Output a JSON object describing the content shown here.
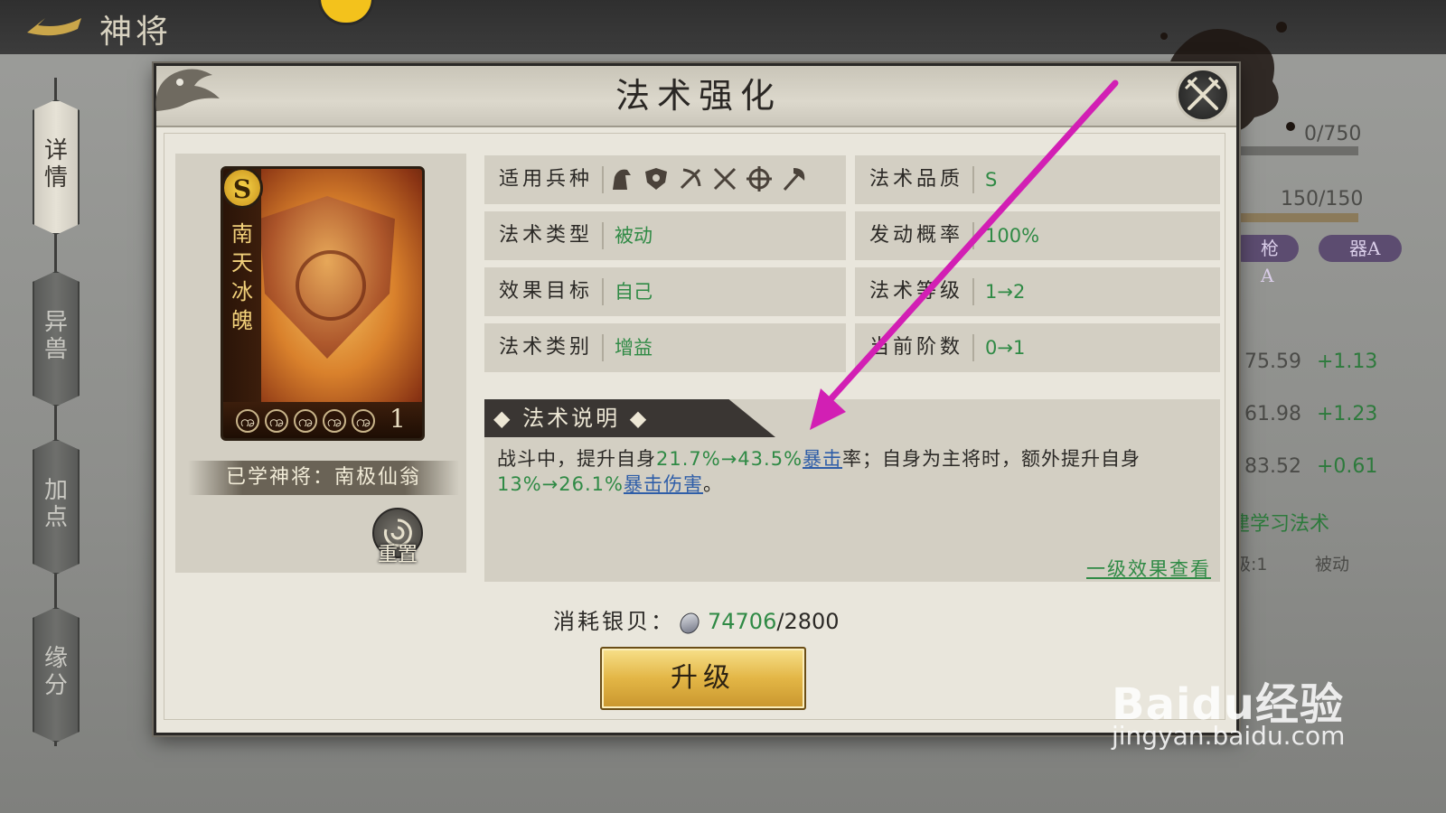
{
  "page": {
    "title": "神将",
    "side_tabs": [
      "详情",
      "异兽",
      "加点",
      "缘分"
    ]
  },
  "background_panel": {
    "progress_1": "0/750",
    "progress_2": "150/150",
    "tag_1": "枪A",
    "tag_2": "器A",
    "stats": [
      {
        "value": "75.59",
        "delta": "+1.13"
      },
      {
        "value": "61.98",
        "delta": "+1.23"
      },
      {
        "value": "83.52",
        "delta": "+0.61"
      }
    ],
    "learn_link": "建学习法术",
    "level_text": "级:1",
    "type_text": "被动"
  },
  "dialog": {
    "title": "法术强化",
    "card": {
      "grade": "S",
      "name": "南天冰魄",
      "level": "1"
    },
    "learned_by": "已学神将：南极仙翁",
    "reset_label": "重置",
    "info": {
      "unit_type": {
        "label": "适用兵种",
        "icons": [
          "cavalry-icon",
          "shield-icon",
          "bow-icon",
          "crossed-swords-icon",
          "crosshair-icon",
          "axe-icon"
        ]
      },
      "quality": {
        "label": "法术品质",
        "value": "S"
      },
      "spell_type": {
        "label": "法术类型",
        "value": "被动"
      },
      "trigger_rate": {
        "label": "发动概率",
        "value": "100%"
      },
      "target": {
        "label": "效果目标",
        "value": "自己"
      },
      "spell_level": {
        "label": "法术等级",
        "value": "1→2"
      },
      "category": {
        "label": "法术类别",
        "value": "增益"
      },
      "stage": {
        "label": "当前阶数",
        "value": "0→1"
      }
    },
    "description": {
      "heading": "法术说明",
      "p1": "战斗中，提升自身",
      "v1": "21.7%→43.5%",
      "link1": "暴击",
      "p2": "率；自身为主将时，额外提升自身",
      "v2": "13%→26.1%",
      "link2": "暴击伤害",
      "p3": "。"
    },
    "level1_link": "一级效果查看",
    "cost": {
      "label": "消耗银贝：",
      "owned": "74706",
      "required": "/2800"
    },
    "upgrade_label": "升级"
  },
  "watermark": {
    "logo": "Baidu经验",
    "url": "jingyan.baidu.com"
  },
  "colors": {
    "value_green": "#2f8a45",
    "link_blue": "#2f5ea8",
    "annotation_arrow": "#d21fb4",
    "upgrade_gold": "#e3b646"
  }
}
